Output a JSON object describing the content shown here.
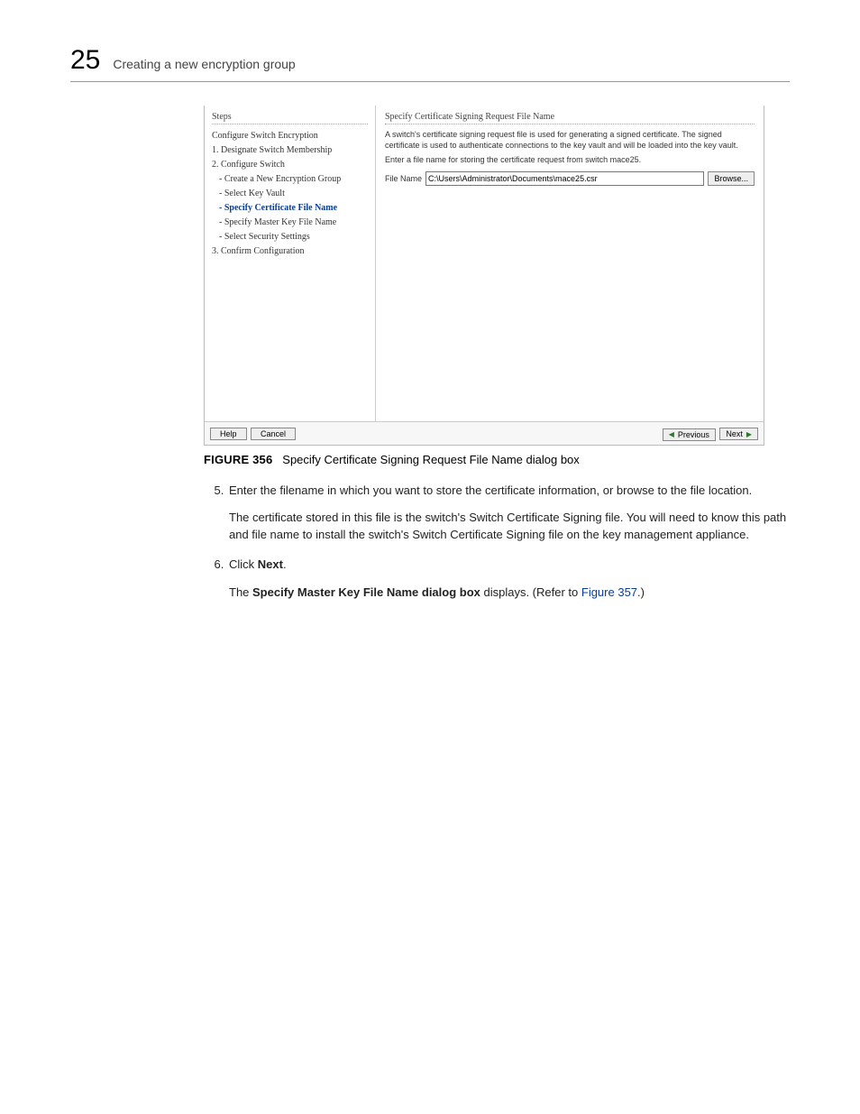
{
  "header": {
    "chapter_number": "25",
    "title": "Creating a new encryption group"
  },
  "wizard": {
    "steps_header": "Steps",
    "section": "Configure Switch Encryption",
    "step1": "1. Designate Switch Membership",
    "step2": "2. Configure Switch",
    "sub_a": "- Create a New Encryption Group",
    "sub_b": "- Select Key Vault",
    "sub_c": "- Specify Certificate File Name",
    "sub_d": "- Specify Master Key File Name",
    "sub_e": "- Select Security Settings",
    "step3": "3. Confirm Configuration",
    "main_title": "Specify Certificate Signing Request File Name",
    "main_para1": "A switch's certificate signing request file is used for generating a signed certificate. The signed certificate is used to authenticate connections to the key vault and will be loaded into the key vault.",
    "main_para2": "Enter a file name for storing the certificate request from switch mace25.",
    "filename_label": "File Name",
    "filename_value": "C:\\Users\\Administrator\\Documents\\mace25.csr",
    "browse": "Browse...",
    "help": "Help",
    "cancel": "Cancel",
    "previous": "Previous",
    "next": "Next"
  },
  "caption": {
    "label": "FIGURE 356",
    "text": "Specify Certificate Signing Request File Name dialog box"
  },
  "steps": {
    "s5_text": "Enter the filename in which you want to store the certificate information, or browse to the file location.",
    "s5_note": "The certificate stored in this file is the switch's Switch Certificate Signing file. You will need to know this path and file name to install the switch's Switch Certificate Signing file on the key management appliance.",
    "s6_prefix": "Click ",
    "s6_bold": "Next",
    "s6_suffix": ".",
    "s6_result_prefix": "The ",
    "s6_result_bold": "Specify Master Key File Name dialog box",
    "s6_result_middle": " displays. (Refer to ",
    "s6_result_link": "Figure 357",
    "s6_result_suffix": ".)"
  }
}
